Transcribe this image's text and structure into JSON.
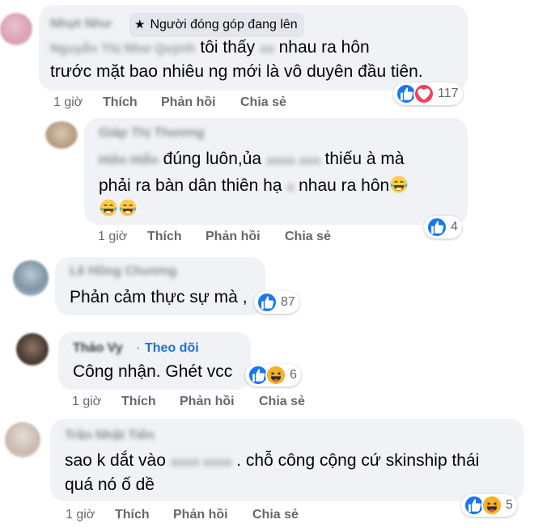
{
  "comments": [
    {
      "badge": "Người đóng góp đang lên",
      "lines": [
        "tôi thấy",
        "nhau ra hôn",
        "trước mặt bao nhiêu ng mới là vô duyên đầu tiên."
      ],
      "reaction_count": "117",
      "reactions": [
        "like-icon",
        "love-icon"
      ],
      "time": "1 giờ",
      "like": "Thích",
      "reply": "Phản hồi",
      "share": "Chia sẻ"
    },
    {
      "lines": [
        "đúng luôn,ủa",
        "thiếu à mà",
        "phải ra bàn dân thiên hạ",
        "nhau ra hôn"
      ],
      "reaction_count": "4",
      "reactions": [
        "like-icon"
      ],
      "time": "1 giờ",
      "like": "Thích",
      "reply": "Phản hồi",
      "share": "Chia sẻ"
    },
    {
      "lines": [
        "Phản cảm thực sự mà ,"
      ],
      "reaction_count": "87",
      "reactions": [
        "like-icon"
      ]
    },
    {
      "follow": "Theo dõi",
      "lines": [
        "Công nhận. Ghét vcc"
      ],
      "reaction_count": "6",
      "reactions": [
        "like-icon",
        "haha-icon"
      ],
      "time": "1 giờ",
      "like": "Thích",
      "reply": "Phản hồi",
      "share": "Chia sẻ"
    },
    {
      "lines": [
        "sao k dắt vào",
        ". chỗ công cộng cứ skinship thái",
        "quá nó ố dề"
      ],
      "reaction_count": "5",
      "reactions": [
        "like-icon",
        "haha-icon"
      ],
      "time": "1 giờ",
      "like": "Thích",
      "reply": "Phản hồi",
      "share": "Chia sẻ"
    }
  ],
  "colors": {
    "bubble": "#f0f2f5",
    "like": "#1877f2",
    "love": "#f33e58",
    "haha": "#f7b125",
    "link": "#216fdb",
    "meta": "#65676b"
  }
}
